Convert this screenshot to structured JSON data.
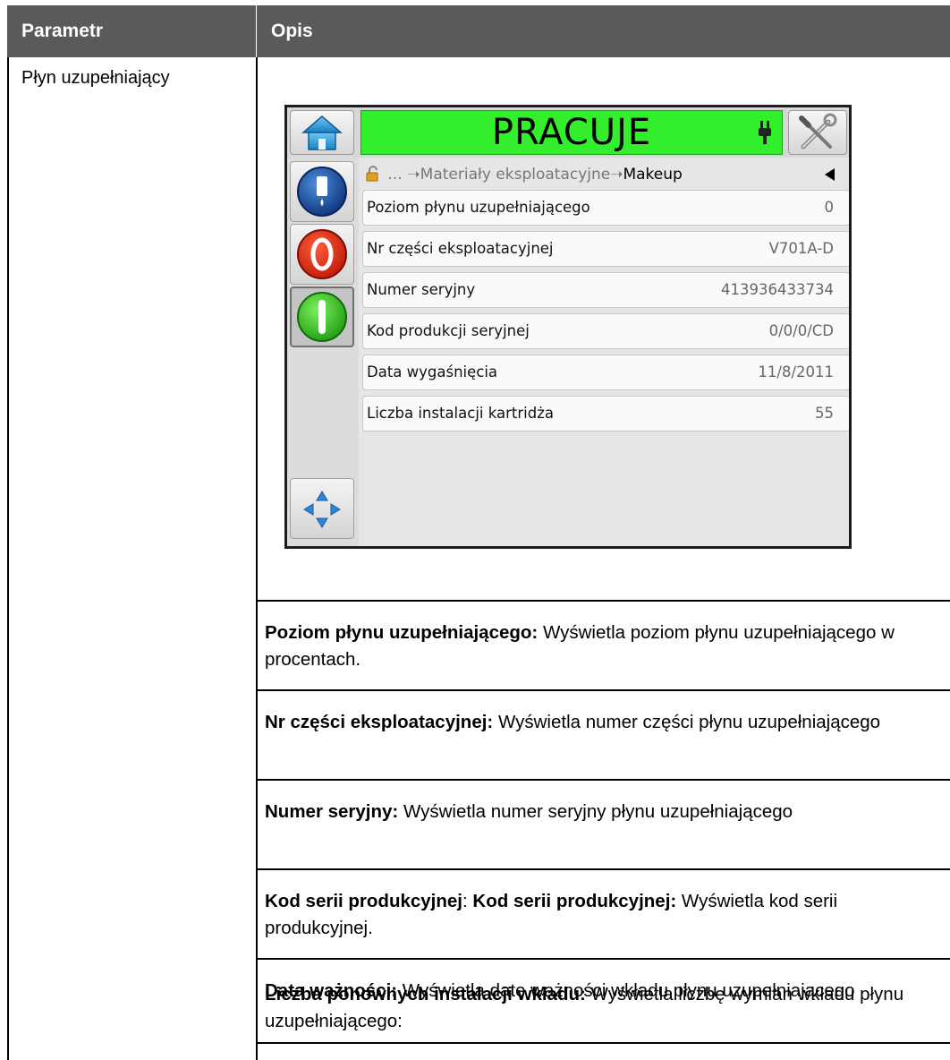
{
  "table": {
    "header": {
      "param": "Parametr",
      "desc": "Opis"
    },
    "param_name": "Płyn uzupełniający",
    "descriptions": [
      {
        "bold": "Poziom płynu uzupełniającego:",
        "text": " Wyświetla poziom płynu uzupełniającego w procentach."
      },
      {
        "bold": "Nr części eksploatacyjnej:",
        "text": " Wyświetla numer części płynu uzupełniającego"
      },
      {
        "bold": "Numer seryjny:",
        "text": " Wyświetla numer seryjny płynu uzupełniającego"
      },
      {
        "bold": "Kod serii produkcyjnej",
        "sep": ": ",
        "bold2": "Kod serii produkcyjnej:",
        "text": " Wyświetla kod serii produkcyjnej."
      },
      {
        "bold": "Data ważności:",
        "text": " Wyświetla datę ważności wkładu płynu uzupełniającego"
      },
      {
        "bold": "Liczba ponownych instalacji wkładu:",
        "text": " Wyświetla liczbę wymian wkładu płynu uzupełniającego:"
      }
    ]
  },
  "screen": {
    "status": "PRACUJE",
    "status_color": "#33ee2c",
    "icons": {
      "home": "home-icon",
      "tools": "tools-icon",
      "plug": "plug-icon",
      "lock": "lock-icon",
      "ink": "ink-cartridge-icon",
      "stop": "stop-icon",
      "start": "start-icon",
      "nav": "navigation-arrows-icon",
      "back": "back-arrow-icon"
    },
    "breadcrumb": {
      "prefix": "… ➝Materiały eksploatacyjne➝",
      "current": "Makeup"
    },
    "rows": [
      {
        "label": "Poziom płynu uzupełniającego",
        "value": "0"
      },
      {
        "label": "Nr części eksploatacyjnej",
        "value": "V701A-D"
      },
      {
        "label": "Numer seryjny",
        "value": "413936433734"
      },
      {
        "label": "Kod produkcji seryjnej",
        "value": "0/0/0/CD"
      },
      {
        "label": "Data wygaśnięcia",
        "value": "11/8/2011"
      },
      {
        "label": "Liczba instalacji kartridża",
        "value": "55"
      }
    ]
  }
}
